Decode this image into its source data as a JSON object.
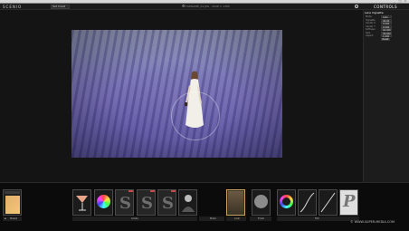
{
  "titlebar": {
    "minimize": "_",
    "maximize": "□",
    "close": "×"
  },
  "app": {
    "name": "SCENIO",
    "menu_selected": "Set Creat",
    "file_info": "FILENAME_01.JPG  ·  2048 × 1365",
    "controls_label": "CONTROLS"
  },
  "panel": {
    "title": "Lens Vignette",
    "params": [
      {
        "label": "Mode",
        "value": "Auto"
      },
      {
        "label": "Vignette",
        "value": "46.00"
      },
      {
        "label": "Center X",
        "value": "0.500"
      },
      {
        "label": "Center Y",
        "value": "0.500"
      },
      {
        "label": "Softness",
        "value": "94.000"
      },
      {
        "label": "Size",
        "value": "36.000"
      },
      {
        "label": "Aspect",
        "value": "1.000"
      }
    ],
    "reset_label": "Reset"
  },
  "bottom": {
    "left_bar_label": "Preset",
    "groups": [
      {
        "label": "Grade",
        "tag": "grade"
      },
      {
        "label": "Mode",
        "tag": "mode"
      },
      {
        "label": "Look",
        "tag": "look"
      },
      {
        "label": "Finish",
        "tag": "finish"
      },
      {
        "label": "Film",
        "tag": "film"
      }
    ],
    "watermark": "© WWW.SUPER-MEDIA.COM"
  },
  "colors": {
    "accent": "#c74a4a",
    "selected": "#c8a463"
  }
}
